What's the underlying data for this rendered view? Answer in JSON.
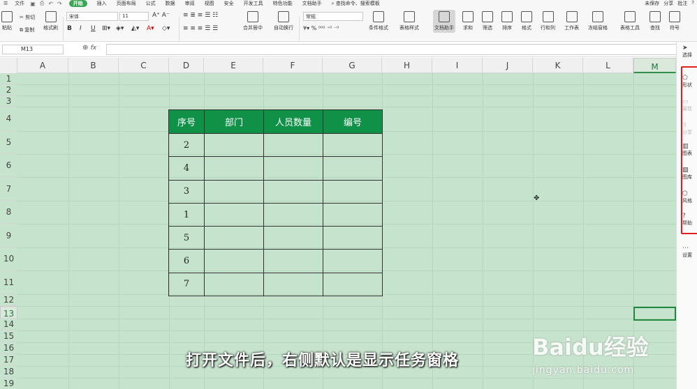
{
  "topbar": {
    "menu_label": "文件",
    "tabs": [
      "开始",
      "插入",
      "页面布局",
      "公式",
      "数据",
      "审阅",
      "视图",
      "安全",
      "开发工具",
      "特色功能",
      "文档助手"
    ],
    "search": "查找命令、搜索模板",
    "right_items": [
      "未保存",
      "分享",
      "批注"
    ],
    "help": "?"
  },
  "ribbon": {
    "paste": "粘贴",
    "cut": "剪切",
    "copy": "复制",
    "format_painter": "格式刷",
    "font_name": "宋体",
    "font_size": "11",
    "number_format": "常规",
    "merge": "合并居中",
    "wrap": "自动换行",
    "cond_format": "条件格式",
    "table_style": "表格样式",
    "doc_helper": "文档助手",
    "sum": "求和",
    "filter": "筛选",
    "sort": "排序",
    "format": "格式",
    "row_col": "行和列",
    "worksheet": "工作表",
    "freeze": "冻结窗格",
    "table_tools": "表格工具",
    "find": "查找",
    "symbol": "符号"
  },
  "formula_bar": {
    "name_box": "M13",
    "fx": "fx",
    "value": ""
  },
  "columns": [
    "A",
    "B",
    "C",
    "D",
    "E",
    "F",
    "G",
    "H",
    "I",
    "J",
    "K",
    "L",
    "M"
  ],
  "rows": [
    "1",
    "2",
    "3",
    "4",
    "5",
    "6",
    "7",
    "8",
    "9",
    "10",
    "11",
    "12",
    "13",
    "14",
    "15",
    "16",
    "17",
    "18",
    "19"
  ],
  "table": {
    "headers": [
      "序号",
      "部门",
      "人员数量",
      "编号"
    ],
    "rows": [
      [
        "2",
        "",
        "",
        ""
      ],
      [
        "4",
        "",
        "",
        ""
      ],
      [
        "3",
        "",
        "",
        ""
      ],
      [
        "1",
        "",
        "",
        ""
      ],
      [
        "5",
        "",
        "",
        ""
      ],
      [
        "6",
        "",
        "",
        ""
      ],
      [
        "7",
        "",
        "",
        ""
      ]
    ]
  },
  "task_pane": {
    "top": "选择",
    "items": [
      "形状",
      "属性",
      "分享",
      "图表",
      "图库",
      "风格",
      "帮助"
    ],
    "bottom": "设置"
  },
  "subtitle": "打开文件后，右侧默认是显示任务窗格",
  "watermark": {
    "brand": "Baidu经验",
    "url": "jingyan.baidu.com"
  },
  "colors": {
    "sheet_bg": "#c6e3cd",
    "header_green": "#0f9147",
    "highlight_red": "#e01e1e",
    "active_tab": "#3aa655"
  }
}
